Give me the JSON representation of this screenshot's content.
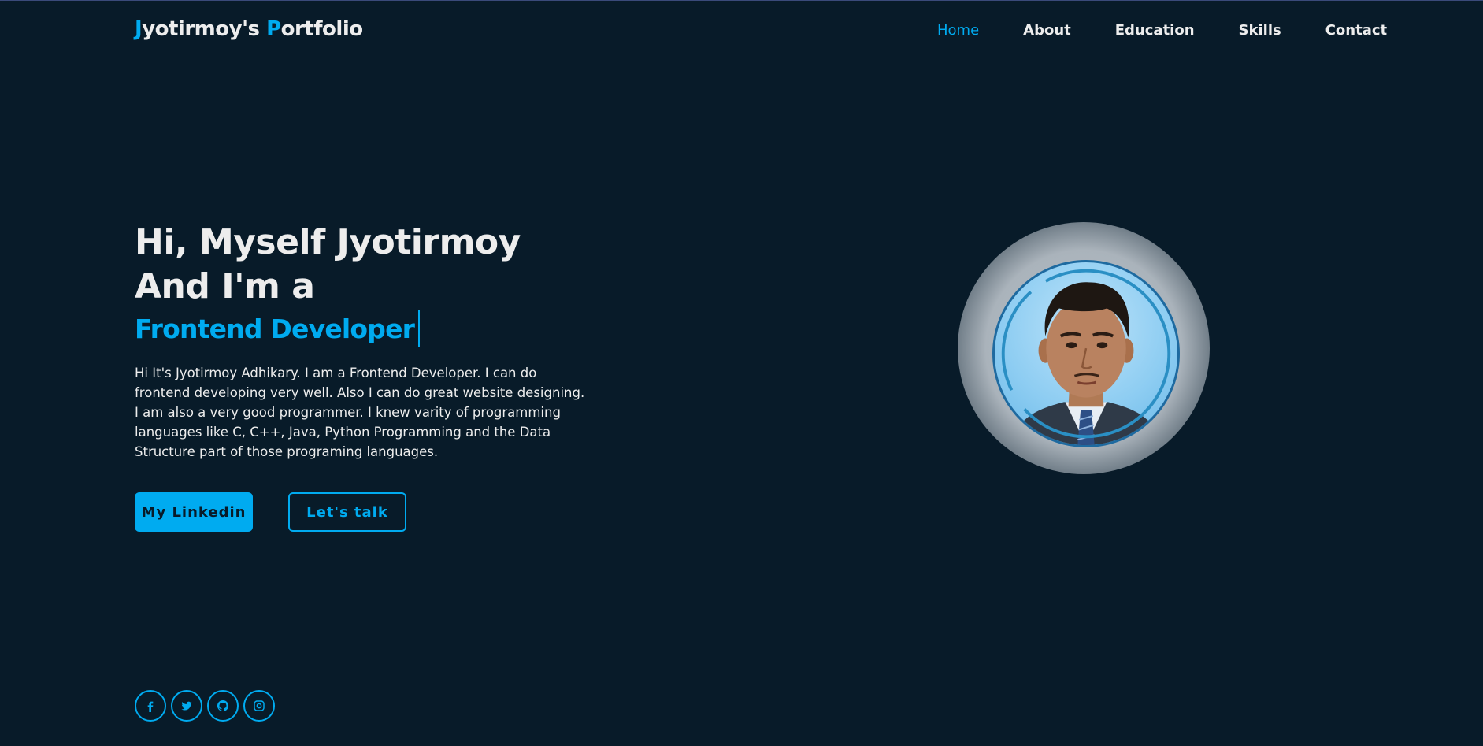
{
  "header": {
    "logo": {
      "first_initial": "J",
      "first_rest": "yotirmoy's ",
      "second_initial": "P",
      "second_rest": "ortfolio"
    },
    "nav": [
      {
        "label": "Home",
        "active": true
      },
      {
        "label": "About",
        "active": false
      },
      {
        "label": "Education",
        "active": false
      },
      {
        "label": "Skills",
        "active": false
      },
      {
        "label": "Contact",
        "active": false
      }
    ]
  },
  "hero": {
    "line1": "Hi, Myself Jyotirmoy",
    "line2": "And I'm a",
    "role": "Frontend Developer",
    "bio": "Hi It's Jyotirmoy Adhikary. I am a Frontend Developer. I can do frontend developing very well. Also I can do great website designing. I am also a very good programmer. I knew varity of programming languages like C, C++, Java, Python Programming and the Data Structure part of those programing languages.",
    "buttons": {
      "primary": "My Linkedin",
      "secondary": "Let's talk"
    }
  },
  "social": [
    "facebook-icon",
    "twitter-icon",
    "github-icon",
    "instagram-icon"
  ],
  "colors": {
    "background": "#081b29",
    "accent": "#00abf0",
    "text": "#ededed"
  }
}
